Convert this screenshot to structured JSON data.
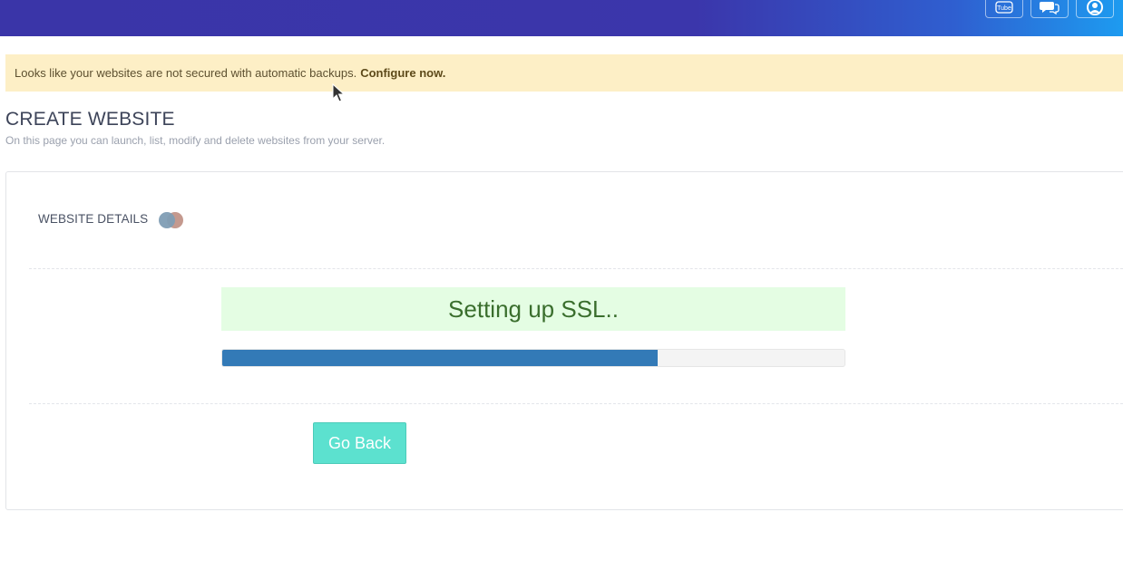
{
  "header": {
    "icons": [
      "youtube-icon",
      "chat-icon",
      "support-icon"
    ],
    "youtube_text": "Tube"
  },
  "alert": {
    "message": "Looks like your websites are not secured with automatic backups.",
    "link_label": "Configure now."
  },
  "page": {
    "title": "CREATE WEBSITE",
    "subtitle": "On this page you can launch, list, modify and delete websites from your server."
  },
  "panel": {
    "section_title": "WEBSITE DETAILS",
    "status_message": "Setting up SSL..",
    "progress_percent": 70,
    "go_back_label": "Go Back"
  },
  "colors": {
    "header_start": "#3a35a8",
    "header_end": "#1d9bf0",
    "alert_bg": "#fdefc6",
    "status_bg": "#e4fde3",
    "progress_fill": "#337ab7",
    "button_bg": "#5ce1cf"
  }
}
